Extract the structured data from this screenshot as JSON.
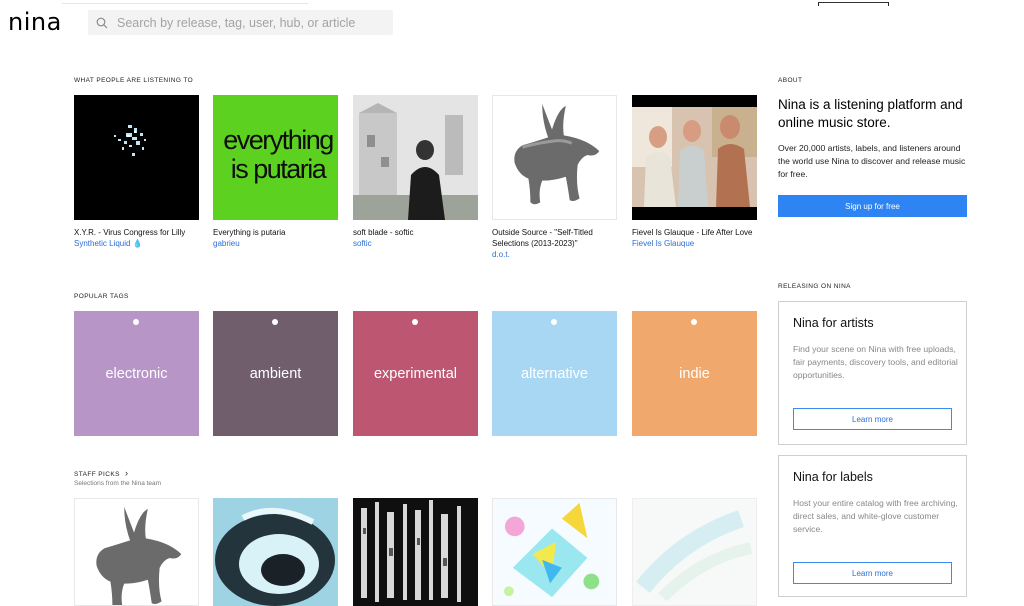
{
  "header": {
    "logo": "nina",
    "search_placeholder": "Search by release, tag, user, hub, or article"
  },
  "listening": {
    "label": "WHAT PEOPLE ARE LISTENING TO",
    "items": [
      {
        "title": "X.Y.R. - Virus Congress for Lilly",
        "artist": "Synthetic Liquid 💧"
      },
      {
        "title": "Everything is putaria",
        "artist": "gabrieu",
        "cover_text": "everything is putaria"
      },
      {
        "title": "soft blade - softic",
        "artist": "softic"
      },
      {
        "title": "Outside Source - \"Self-Titled Selections (2013-2023)\"",
        "artist": "d.o.t."
      },
      {
        "title": "Fievel Is Glauque - Life After Love",
        "artist": "Fievel Is Glauque"
      }
    ]
  },
  "tags": {
    "label": "POPULAR TAGS",
    "items": [
      {
        "name": "electronic",
        "color": "#b795c7"
      },
      {
        "name": "ambient",
        "color": "#715e6c"
      },
      {
        "name": "experimental",
        "color": "#bd5771"
      },
      {
        "name": "alternative",
        "color": "#a8d7f3"
      },
      {
        "name": "indie",
        "color": "#f0a86c"
      }
    ]
  },
  "staff_picks": {
    "label": "STAFF PICKS",
    "chevron": "›",
    "subtitle": "Selections from the Nina team"
  },
  "about": {
    "label": "ABOUT",
    "title": "Nina is a listening platform and online music store.",
    "text": "Over 20,000 artists, labels, and listeners around the world use Nina to discover and release music for free.",
    "signup_label": "Sign up for free",
    "accent": "#2f84f4"
  },
  "releasing": {
    "label": "RELEASING ON NINA",
    "artists": {
      "title": "Nina for artists",
      "text": "Find your scene on Nina with free uploads, fair payments, discovery tools, and editorial opportunities.",
      "button": "Learn more"
    },
    "labels": {
      "title": "Nina for labels",
      "text": "Host your entire catalog with free archiving, direct sales, and white-glove customer service.",
      "button": "Learn more"
    }
  }
}
